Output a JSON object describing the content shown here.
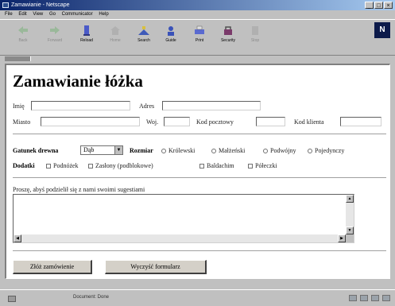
{
  "window": {
    "title": "Zamawianie - Netscape"
  },
  "menubar": [
    "File",
    "Edit",
    "View",
    "Go",
    "Communicator",
    "Help"
  ],
  "toolbar": {
    "buttons": [
      {
        "label": "Back",
        "icon": "back-arrow-icon",
        "enabled": false
      },
      {
        "label": "Forward",
        "icon": "forward-arrow-icon",
        "enabled": false
      },
      {
        "label": "Reload",
        "icon": "reload-icon",
        "enabled": true
      },
      {
        "label": "Home",
        "icon": "home-icon",
        "enabled": false
      },
      {
        "label": "Search",
        "icon": "search-icon",
        "enabled": true
      },
      {
        "label": "Guide",
        "icon": "guide-icon",
        "enabled": true
      },
      {
        "label": "Print",
        "icon": "print-icon",
        "enabled": true
      },
      {
        "label": "Security",
        "icon": "security-lock-icon",
        "enabled": true
      },
      {
        "label": "Stop",
        "icon": "stop-icon",
        "enabled": false
      }
    ],
    "logo": "N"
  },
  "form": {
    "heading": "Zamawianie łóżka",
    "fields": {
      "imie": {
        "label": "Imię",
        "value": ""
      },
      "adres": {
        "label": "Adres",
        "value": ""
      },
      "miasto": {
        "label": "Miasto",
        "value": ""
      },
      "woj": {
        "label": "Woj.",
        "value": ""
      },
      "kod_pocztowy": {
        "label": "Kod pocztowy",
        "value": ""
      },
      "kod_klienta": {
        "label": "Kod klienta",
        "value": ""
      }
    },
    "gatunek": {
      "label": "Gatunek drewna",
      "selected": "Dąb"
    },
    "rozmiar": {
      "label": "Rozmiar",
      "options": [
        "Królewski",
        "Małżeński",
        "Podwójny",
        "Pojedynczy"
      ],
      "selected": null
    },
    "dodatki": {
      "label": "Dodatki",
      "options": [
        "Podnóżek",
        "Zasłony (podblokowe)",
        "Baldachim",
        "Półeczki"
      ],
      "checked": []
    },
    "comment": {
      "label": "Proszę, abyś podzielił się z nami swoimi sugestiami",
      "value": ""
    },
    "submit_label": "Złóż zamówienie",
    "reset_label": "Wyczyść formularz"
  },
  "status": {
    "text": "Document: Done"
  },
  "colors": {
    "titlebar_start": "#0a246a",
    "titlebar_end": "#a6caf0",
    "chrome": "#c0c0c0"
  }
}
